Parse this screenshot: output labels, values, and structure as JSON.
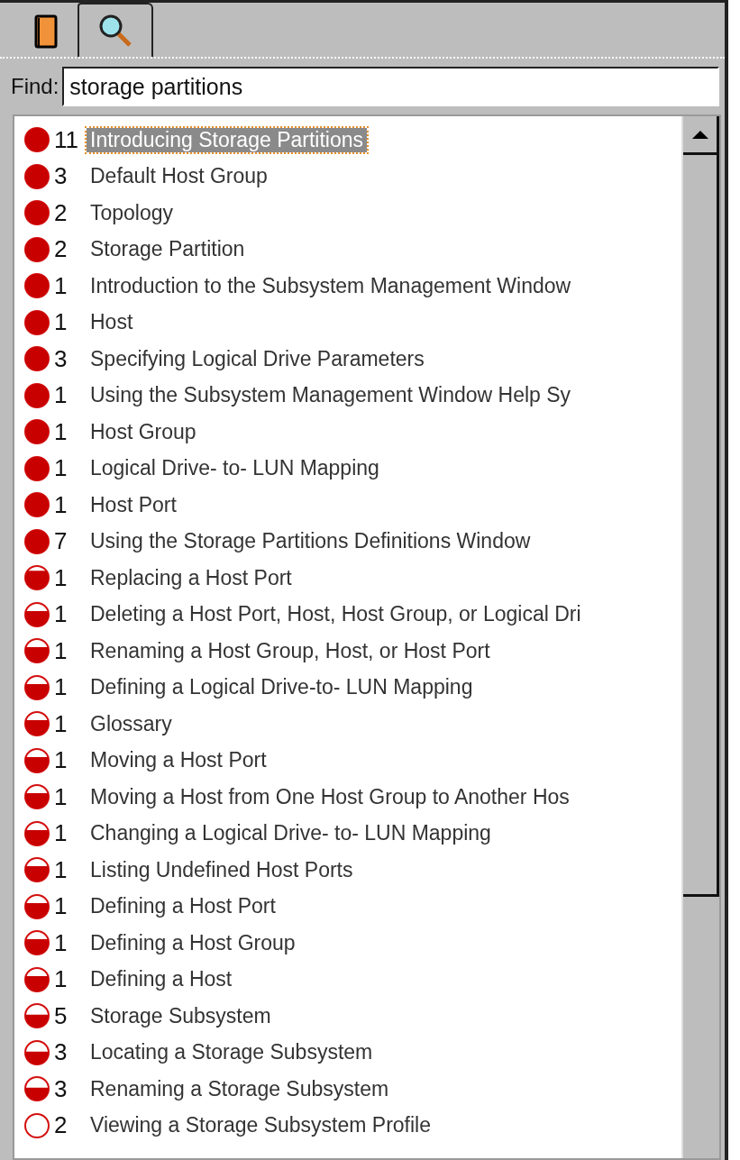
{
  "tabs": [
    {
      "kind": "book",
      "selected": false
    },
    {
      "kind": "search",
      "selected": true
    }
  ],
  "find": {
    "label": "Find:",
    "value": "storage partitions"
  },
  "results": [
    {
      "count": "11",
      "title": "Introducing Storage Partitions",
      "kind": "full",
      "selected": true
    },
    {
      "count": "3",
      "title": "Default Host Group",
      "kind": "full",
      "selected": false
    },
    {
      "count": "2",
      "title": "Topology",
      "kind": "full",
      "selected": false
    },
    {
      "count": "2",
      "title": "Storage Partition",
      "kind": "full",
      "selected": false
    },
    {
      "count": "1",
      "title": "Introduction to the Subsystem Management Window",
      "kind": "full",
      "selected": false
    },
    {
      "count": "1",
      "title": "Host",
      "kind": "full",
      "selected": false
    },
    {
      "count": "3",
      "title": "Specifying Logical Drive Parameters",
      "kind": "full",
      "selected": false
    },
    {
      "count": "1",
      "title": "Using the Subsystem Management Window Help Sy",
      "kind": "full",
      "selected": false
    },
    {
      "count": "1",
      "title": "Host Group",
      "kind": "full",
      "selected": false
    },
    {
      "count": "1",
      "title": "Logical Drive- to- LUN Mapping",
      "kind": "full",
      "selected": false
    },
    {
      "count": "1",
      "title": "Host Port",
      "kind": "full",
      "selected": false
    },
    {
      "count": "7",
      "title": "Using the Storage Partitions Definitions Window",
      "kind": "full",
      "selected": false
    },
    {
      "count": "1",
      "title": "Replacing a Host Port",
      "kind": "high",
      "selected": false
    },
    {
      "count": "1",
      "title": "Deleting a Host Port, Host, Host Group, or Logical Dri",
      "kind": "medium",
      "selected": false
    },
    {
      "count": "1",
      "title": "Renaming a Host Group, Host, or Host Port",
      "kind": "medium",
      "selected": false
    },
    {
      "count": "1",
      "title": "Defining a Logical Drive-to- LUN Mapping",
      "kind": "medium",
      "selected": false
    },
    {
      "count": "1",
      "title": "Glossary",
      "kind": "medium",
      "selected": false
    },
    {
      "count": "1",
      "title": "Moving a Host Port",
      "kind": "medium",
      "selected": false
    },
    {
      "count": "1",
      "title": "Moving a Host from One Host Group to Another Hos",
      "kind": "medium",
      "selected": false
    },
    {
      "count": "1",
      "title": "Changing a Logical Drive- to- LUN Mapping",
      "kind": "medium",
      "selected": false
    },
    {
      "count": "1",
      "title": "Listing Undefined Host Ports",
      "kind": "medium",
      "selected": false
    },
    {
      "count": "1",
      "title": "Defining a Host Port",
      "kind": "medium",
      "selected": false
    },
    {
      "count": "1",
      "title": "Defining a Host Group",
      "kind": "medium",
      "selected": false
    },
    {
      "count": "1",
      "title": "Defining a Host",
      "kind": "medium",
      "selected": false
    },
    {
      "count": "5",
      "title": "Storage Subsystem",
      "kind": "half",
      "selected": false
    },
    {
      "count": "3",
      "title": "Locating a Storage Subsystem",
      "kind": "half",
      "selected": false
    },
    {
      "count": "3",
      "title": "Renaming a Storage Subsystem",
      "kind": "half",
      "selected": false
    },
    {
      "count": "2",
      "title": "Viewing a Storage Subsystem Profile",
      "kind": "empty",
      "selected": false
    }
  ]
}
